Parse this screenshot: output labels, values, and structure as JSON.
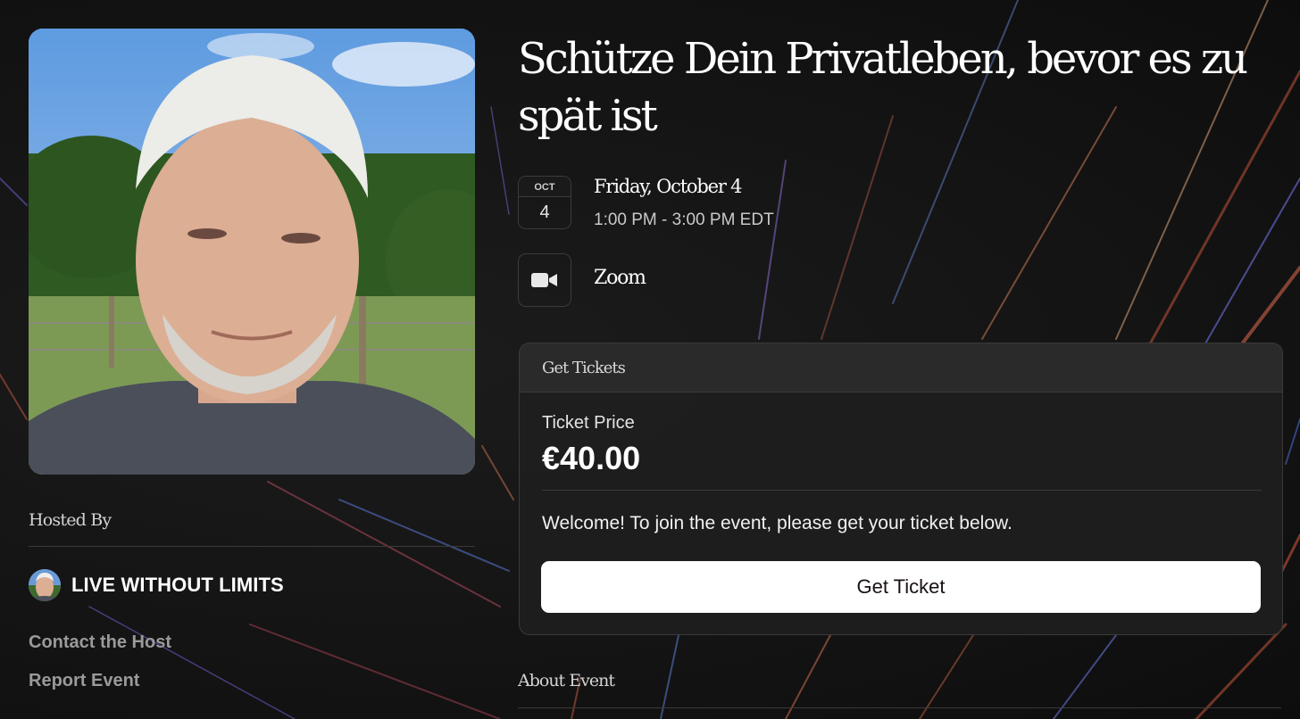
{
  "event": {
    "title": "Schütze Dein Privatleben, bevor es zu spät ist",
    "calendar": {
      "month": "OCT",
      "day": "4"
    },
    "date": "Friday, October 4",
    "time": "1:00 PM - 3:00 PM EDT",
    "location": {
      "name": "Zoom",
      "icon": "video-camera-icon"
    }
  },
  "host": {
    "section_label": "Hosted By",
    "name": "LIVE WITHOUT LIMITS",
    "links": {
      "contact": "Contact the Host",
      "report": "Report Event"
    }
  },
  "tickets": {
    "header": "Get Tickets",
    "price_label": "Ticket Price",
    "price": "€40.00",
    "welcome": "Welcome! To join the event, please get your ticket below.",
    "button": "Get Ticket"
  },
  "about": {
    "label": "About Event"
  },
  "colors": {
    "background": "#141414",
    "card": "#1e1e1e",
    "button_bg": "#ffffff",
    "button_text": "#1a1212",
    "muted_text": "#9a9a9a"
  }
}
